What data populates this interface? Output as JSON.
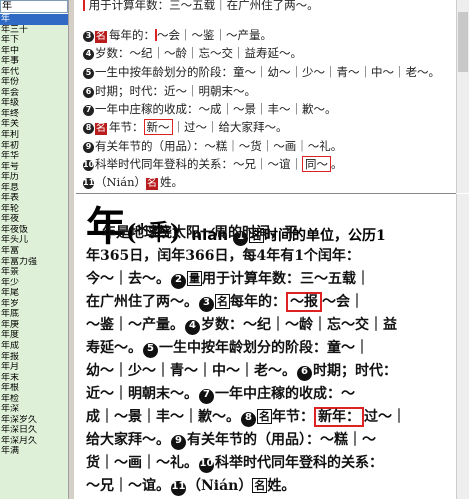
{
  "search": {
    "value": "年"
  },
  "wordlist": [
    "年",
    "年三十",
    "年下",
    "年中",
    "年事",
    "年代",
    "年份",
    "年会",
    "年级",
    "年终",
    "年关",
    "年利",
    "年初",
    "年华",
    "年号",
    "年历",
    "年息",
    "年表",
    "年轮",
    "年夜",
    "年夜饭",
    "年头儿",
    "年富",
    "年富力强",
    "年景",
    "年少",
    "年尾",
    "年岁",
    "年底",
    "年庚",
    "年度",
    "年成",
    "年报",
    "年月",
    "年末",
    "年根",
    "年检",
    "年深",
    "年深岁久",
    "年深日久",
    "年深月久",
    "年满"
  ],
  "top_panel": {
    "sense2_tail": "用于计算年数：三～五载｜在广州住了两～。",
    "sense3": {
      "num": "3",
      "badge": "名",
      "text_a": "每年的：",
      "text_b": "～会｜～鉴｜～产量。"
    },
    "sense4": {
      "num": "4",
      "text": "岁数：～纪｜～龄｜忘～交｜益寿延～。"
    },
    "sense5": {
      "num": "5",
      "text": "一生中按年龄划分的阶段：童～｜幼～｜少～｜青～｜中～｜老～。"
    },
    "sense6": {
      "num": "6",
      "text": "时期；时代：近～｜明朝末～。"
    },
    "sense7": {
      "num": "7",
      "text": "一年中庄稼的收成：～成｜～景｜丰～｜歉～。"
    },
    "sense8": {
      "num": "8",
      "badge": "名",
      "text_a": "年节：",
      "boxed": "新～",
      "text_b": "｜过～｜给大家拜～。"
    },
    "sense9": {
      "num": "9",
      "text": "有关年节的（用品）：～糕｜～货｜～画｜～礼。"
    },
    "sense10": {
      "num": "10",
      "text_a": "科举时代同年登科的关系：～兄｜～谊｜",
      "boxed": "同～",
      "text_b": "。"
    },
    "sense11": {
      "num": "11",
      "text_a": "（Nián）",
      "badge": "名",
      "text_b": "姓。"
    }
  },
  "entry": {
    "headword": "年",
    "variant": "(*秊)",
    "pinyin": "nián",
    "lines": [
      {
        "parts": [
          {
            "c": "1"
          },
          {
            "b": "名"
          },
          {
            "t": "时间的单位，公历1"
          }
        ]
      },
      {
        "parts": [
          {
            "t": "年是地球绕太阳一周的时间，平"
          }
        ]
      },
      {
        "parts": [
          {
            "t": "年365日，闰年366日，每4年有1个闰年："
          }
        ]
      },
      {
        "parts": [
          {
            "t": "今～｜去～。"
          },
          {
            "c": "2"
          },
          {
            "b": "量"
          },
          {
            "t": "用于计算年数：三～五载｜"
          }
        ]
      },
      {
        "parts": [
          {
            "t": "在广州住了两～。"
          },
          {
            "c": "3"
          },
          {
            "b": "名"
          },
          {
            "t": "每年的："
          },
          {
            "r": "～报"
          },
          {
            "t": "～会｜"
          }
        ]
      },
      {
        "parts": [
          {
            "t": "～鉴｜～产量。"
          },
          {
            "c": "4"
          },
          {
            "t": "岁数：～纪｜～龄｜忘～交｜益"
          }
        ]
      },
      {
        "parts": [
          {
            "t": "寿延～。"
          },
          {
            "c": "5"
          },
          {
            "t": "一生中按年龄划分的阶段：童～｜"
          }
        ]
      },
      {
        "parts": [
          {
            "t": "幼～｜少～｜青～｜中～｜老～。"
          },
          {
            "c": "6"
          },
          {
            "t": "时期；时代："
          }
        ]
      },
      {
        "parts": [
          {
            "t": "近～｜明朝末～。"
          },
          {
            "c": "7"
          },
          {
            "t": "一年中庄稼的收成：～"
          }
        ]
      },
      {
        "parts": [
          {
            "t": "成｜～景｜丰～｜歉～。"
          },
          {
            "c": "8"
          },
          {
            "b": "名"
          },
          {
            "t": "年节："
          },
          {
            "r": "新年："
          },
          {
            "t": "过～｜"
          }
        ]
      },
      {
        "parts": [
          {
            "t": "给大家拜～。"
          },
          {
            "c": "9"
          },
          {
            "t": "有关年节的（用品）：～糕｜～"
          }
        ]
      },
      {
        "parts": [
          {
            "t": "货｜～画｜～礼。"
          },
          {
            "c": "10"
          },
          {
            "t": "科举时代同年登科的关系："
          }
        ]
      },
      {
        "parts": [
          {
            "t": "～兄｜～谊。"
          },
          {
            "c": "11"
          },
          {
            "t": "（Nián）"
          },
          {
            "b": "名"
          },
          {
            "t": "姓。"
          }
        ]
      }
    ]
  }
}
